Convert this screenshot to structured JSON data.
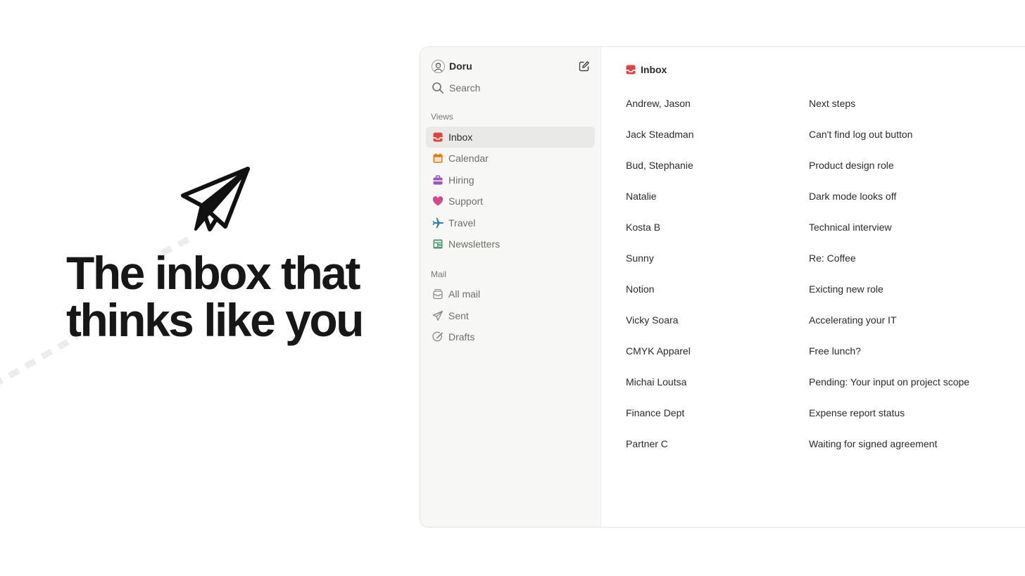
{
  "hero": {
    "headline_line1": "The inbox that",
    "headline_line2": "thinks like you",
    "plane_icon": "paper-plane-icon"
  },
  "sidebar": {
    "user": {
      "name": "Doru",
      "avatar_icon": "user-avatar-icon"
    },
    "compose_icon": "compose-icon",
    "search": {
      "label": "Search",
      "icon": "search-icon"
    },
    "views_title": "Views",
    "views": [
      {
        "label": "Inbox",
        "icon": "inbox-icon",
        "color": "#e0443e",
        "active": true
      },
      {
        "label": "Calendar",
        "icon": "calendar-icon",
        "color": "#e07a12",
        "active": false
      },
      {
        "label": "Hiring",
        "icon": "briefcase-icon",
        "color": "#9b59b6",
        "active": false
      },
      {
        "label": "Support",
        "icon": "heart-icon",
        "color": "#d6478c",
        "active": false
      },
      {
        "label": "Travel",
        "icon": "airplane-icon",
        "color": "#2f7fb6",
        "active": false
      },
      {
        "label": "Newsletters",
        "icon": "newspaper-icon",
        "color": "#4f9a6b",
        "active": false
      }
    ],
    "mail_title": "Mail",
    "mail": [
      {
        "label": "All mail",
        "icon": "archive-icon"
      },
      {
        "label": "Sent",
        "icon": "send-icon"
      },
      {
        "label": "Drafts",
        "icon": "draft-icon"
      }
    ]
  },
  "main": {
    "title": "Inbox",
    "icon": "inbox-icon",
    "messages": [
      {
        "sender": "Andrew, Jason",
        "subject": "Next steps"
      },
      {
        "sender": "Jack Steadman",
        "subject": "Can't find log out button"
      },
      {
        "sender": "Bud, Stephanie",
        "subject": "Product design role"
      },
      {
        "sender": "Natalie",
        "subject": "Dark mode looks off"
      },
      {
        "sender": "Kosta B",
        "subject": "Technical interview"
      },
      {
        "sender": "Sunny",
        "subject": "Re: Coffee"
      },
      {
        "sender": "Notion",
        "subject": "Exicting new role"
      },
      {
        "sender": "Vicky Soara",
        "subject": "Accelerating your IT"
      },
      {
        "sender": "CMYK Apparel",
        "subject": "Free lunch?"
      },
      {
        "sender": "Michai Loutsa",
        "subject": "Pending: Your input on project scope"
      },
      {
        "sender": "Finance Dept",
        "subject": "Expense report status"
      },
      {
        "sender": "Partner C",
        "subject": "Waiting for signed agreement"
      }
    ]
  }
}
